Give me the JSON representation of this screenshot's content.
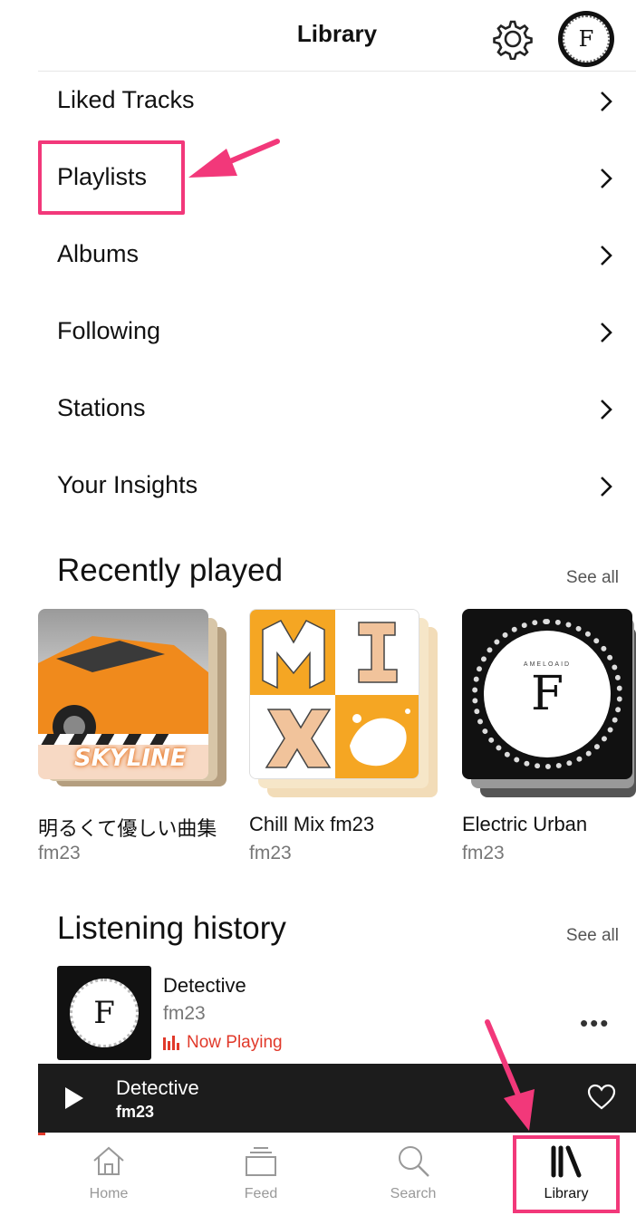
{
  "header": {
    "title": "Library",
    "settings_icon": "gear-icon",
    "avatar_letter": "F"
  },
  "menu": {
    "items": [
      {
        "label": "Liked Tracks"
      },
      {
        "label": "Playlists"
      },
      {
        "label": "Albums"
      },
      {
        "label": "Following"
      },
      {
        "label": "Stations"
      },
      {
        "label": "Your Insights"
      }
    ]
  },
  "recently_played": {
    "title": "Recently played",
    "see_all": "See all",
    "items": [
      {
        "title": "明るくて優しい曲集",
        "subtitle": "fm23",
        "art_text": "SKYLINE"
      },
      {
        "title": "Chill Mix fm23",
        "subtitle": "fm23"
      },
      {
        "title": "Electric Urban",
        "subtitle": "fm23",
        "art_brand": "AMELOAID",
        "art_letter": "F"
      }
    ]
  },
  "listening_history": {
    "title": "Listening history",
    "see_all": "See all",
    "items": [
      {
        "title": "Detective",
        "subtitle": "fm23",
        "status": "Now Playing",
        "art_brand": "AMELOAID",
        "art_letter": "F"
      }
    ]
  },
  "player": {
    "title": "Detective",
    "subtitle": "fm23"
  },
  "tabbar": {
    "tabs": [
      {
        "label": "Home"
      },
      {
        "label": "Feed"
      },
      {
        "label": "Search"
      },
      {
        "label": "Library"
      }
    ],
    "active": "Library"
  },
  "colors": {
    "accent": "#e1392a",
    "highlight": "#f2387a",
    "player_bg": "#1c1c1c"
  }
}
